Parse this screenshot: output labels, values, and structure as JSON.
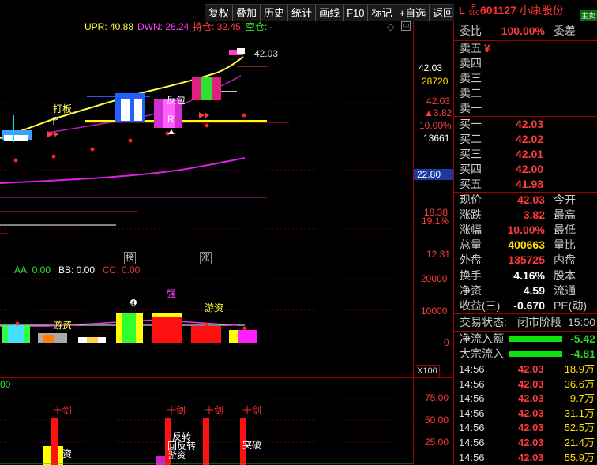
{
  "toolbar": {
    "buttons": [
      "复权",
      "叠加",
      "历史",
      "统计",
      "画线",
      "F10",
      "标记",
      "+自选",
      "返回"
    ]
  },
  "main_chart": {
    "indicator": {
      "upr_label": "UPR: 40.88",
      "dwn_label": "DWN: 26.24",
      "hold_label": "持仓: 32.45",
      "empty_label": "空仓: -"
    },
    "price_marker": "42.03",
    "annotations": [
      "打板",
      "反包",
      "R",
      "P"
    ],
    "bottom_markers": [
      "榜",
      "涨"
    ],
    "axis": [
      "42.03",
      "28720",
      "42.03",
      "▲3.82",
      "10.00%",
      "13661",
      "22.80",
      "18.38",
      "19.1%",
      "12.31"
    ]
  },
  "volume_panel": {
    "aa_label": "AA: 0.00",
    "bb_label": "BB: 0.00",
    "cc_label": "CC: 0.00",
    "annotations": [
      "游资",
      "游资",
      "强",
      "4"
    ],
    "axis": [
      "20000",
      "10000",
      "0",
      "X100"
    ]
  },
  "bottom_panel": {
    "left_label": "00",
    "annotations": [
      "十剑",
      "十剑",
      "十剑",
      "十剑",
      "资",
      "反转",
      "回反转",
      "游资",
      "突破"
    ],
    "axis": [
      "75.00",
      "50.00",
      "25.00"
    ]
  },
  "quote": {
    "header": {
      "mark": "L",
      "badge_top": "R",
      "badge_bottom": "500",
      "code": "601127",
      "name": "小康股份",
      "tag": "主卖"
    },
    "weibi": {
      "label": "委比",
      "value": "100.00%",
      "label2": "委差"
    },
    "asks": [
      {
        "label": "卖五",
        "price": "¥"
      },
      {
        "label": "卖四",
        "price": ""
      },
      {
        "label": "卖三",
        "price": ""
      },
      {
        "label": "卖二",
        "price": ""
      },
      {
        "label": "卖一",
        "price": ""
      }
    ],
    "bids": [
      {
        "label": "买一",
        "price": "42.03"
      },
      {
        "label": "买二",
        "price": "42.02"
      },
      {
        "label": "买三",
        "price": "42.01"
      },
      {
        "label": "买四",
        "price": "42.00"
      },
      {
        "label": "买五",
        "price": "41.98"
      }
    ],
    "stats": [
      {
        "label": "现价",
        "value": "42.03",
        "label2": "今开",
        "color": "red"
      },
      {
        "label": "涨跌",
        "value": "3.82",
        "label2": "最高",
        "color": "red"
      },
      {
        "label": "涨幅",
        "value": "10.00%",
        "label2": "最低",
        "color": "red"
      },
      {
        "label": "总量",
        "value": "400663",
        "label2": "量比",
        "color": "yellow"
      },
      {
        "label": "外盘",
        "value": "135725",
        "label2": "内盘",
        "color": "red"
      }
    ],
    "stats2": [
      {
        "label": "换手",
        "value": "4.16%",
        "label2": "股本",
        "color": "white"
      },
      {
        "label": "净资",
        "value": "4.59",
        "label2": "流通",
        "color": "white"
      },
      {
        "label": "收益(三)",
        "value": "-0.670",
        "label2": "PE(动)",
        "color": "white"
      }
    ],
    "trade_state": {
      "label": "交易状态:",
      "value": "闭市阶段",
      "time": "15:00"
    },
    "flows": [
      {
        "label": "净流入额",
        "value": "-5.42"
      },
      {
        "label": "大宗流入",
        "value": "-4.81"
      }
    ],
    "ticks": [
      {
        "time": "14:56",
        "price": "42.03",
        "vol": "18.9万"
      },
      {
        "time": "14:56",
        "price": "42.03",
        "vol": "36.6万"
      },
      {
        "time": "14:56",
        "price": "42.03",
        "vol": "9.7万"
      },
      {
        "time": "14:56",
        "price": "42.03",
        "vol": "31.1万"
      },
      {
        "time": "14:56",
        "price": "42.03",
        "vol": "52.5万"
      },
      {
        "time": "14:56",
        "price": "42.03",
        "vol": "21.4万"
      },
      {
        "time": "14:56",
        "price": "42.03",
        "vol": "55.9万"
      }
    ]
  }
}
